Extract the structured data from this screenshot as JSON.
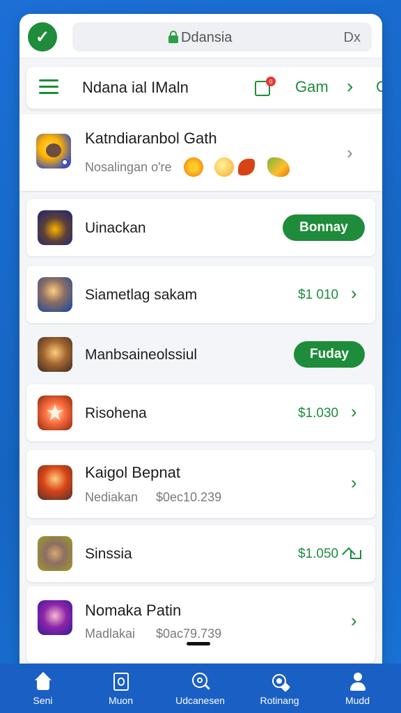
{
  "browser": {
    "url": "Ddansia",
    "close_label": "Dx"
  },
  "appbar": {
    "title": "Ndana ial IMaln",
    "cart_badge": "0",
    "tab_label": "Gam",
    "extra_label": "G"
  },
  "featured": {
    "title": "Katndiaranbol Gath",
    "subtitle": "Nosalingan o're"
  },
  "rows": [
    {
      "title": "Uinackan",
      "action": "Bonnay"
    },
    {
      "title": "Siametlag sakam",
      "price": "$1 010"
    },
    {
      "title": "Manbsaineolssiul",
      "action": "Fuday"
    },
    {
      "title": "Risohena",
      "price": "$1.030"
    },
    {
      "title": "Kaigol Bepnat",
      "subtitle": "Nediakan",
      "sub_price": "$0ec10.239"
    },
    {
      "title": "Sinssia",
      "price": "$1.050"
    },
    {
      "title": "Nomaka Patin",
      "subtitle": "Madlakai",
      "sub_price": "$0ac79.739"
    }
  ],
  "nav": [
    {
      "label": "Seni",
      "icon": "home-icon"
    },
    {
      "label": "Muon",
      "icon": "document-icon"
    },
    {
      "label": "Udcanesen",
      "icon": "search-icon"
    },
    {
      "label": "Rotinang",
      "icon": "discover-icon"
    },
    {
      "label": "Mudd",
      "icon": "profile-icon"
    }
  ],
  "colors": {
    "accent": "#1e8c3a",
    "background": "#1565c0",
    "nav": "#1a5fc4"
  }
}
